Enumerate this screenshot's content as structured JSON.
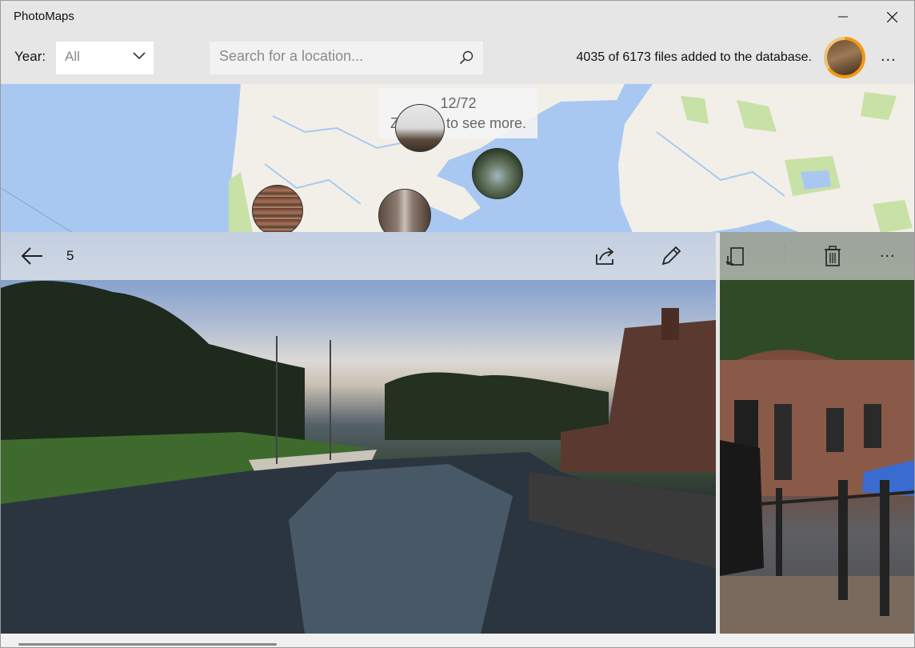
{
  "app": {
    "title": "PhotoMaps"
  },
  "window_controls": {
    "minimize": "minimize-icon",
    "maximize": "maximize-icon",
    "close": "close-icon"
  },
  "toolbar": {
    "year_label": "Year:",
    "year_value": "All",
    "search_placeholder": "Search for a location...",
    "status": "4035 of 6173 files added to the database.",
    "progress_fraction": 0.654,
    "more": "..."
  },
  "map": {
    "badge_count": "12/72",
    "badge_hint": "Zoom in to see more."
  },
  "viewer": {
    "page_number": "5",
    "icons": {
      "back": "back-arrow-icon",
      "share": "share-icon",
      "edit": "edit-pencil-icon"
    }
  },
  "side_panel": {
    "icons": {
      "rotate": "rotate-icon",
      "delete": "trash-icon"
    },
    "more": "..."
  },
  "colors": {
    "accent": "#f29a13",
    "water": "#a9c8f1",
    "land": "#f2efe9",
    "parks": "#c8e1a6"
  }
}
